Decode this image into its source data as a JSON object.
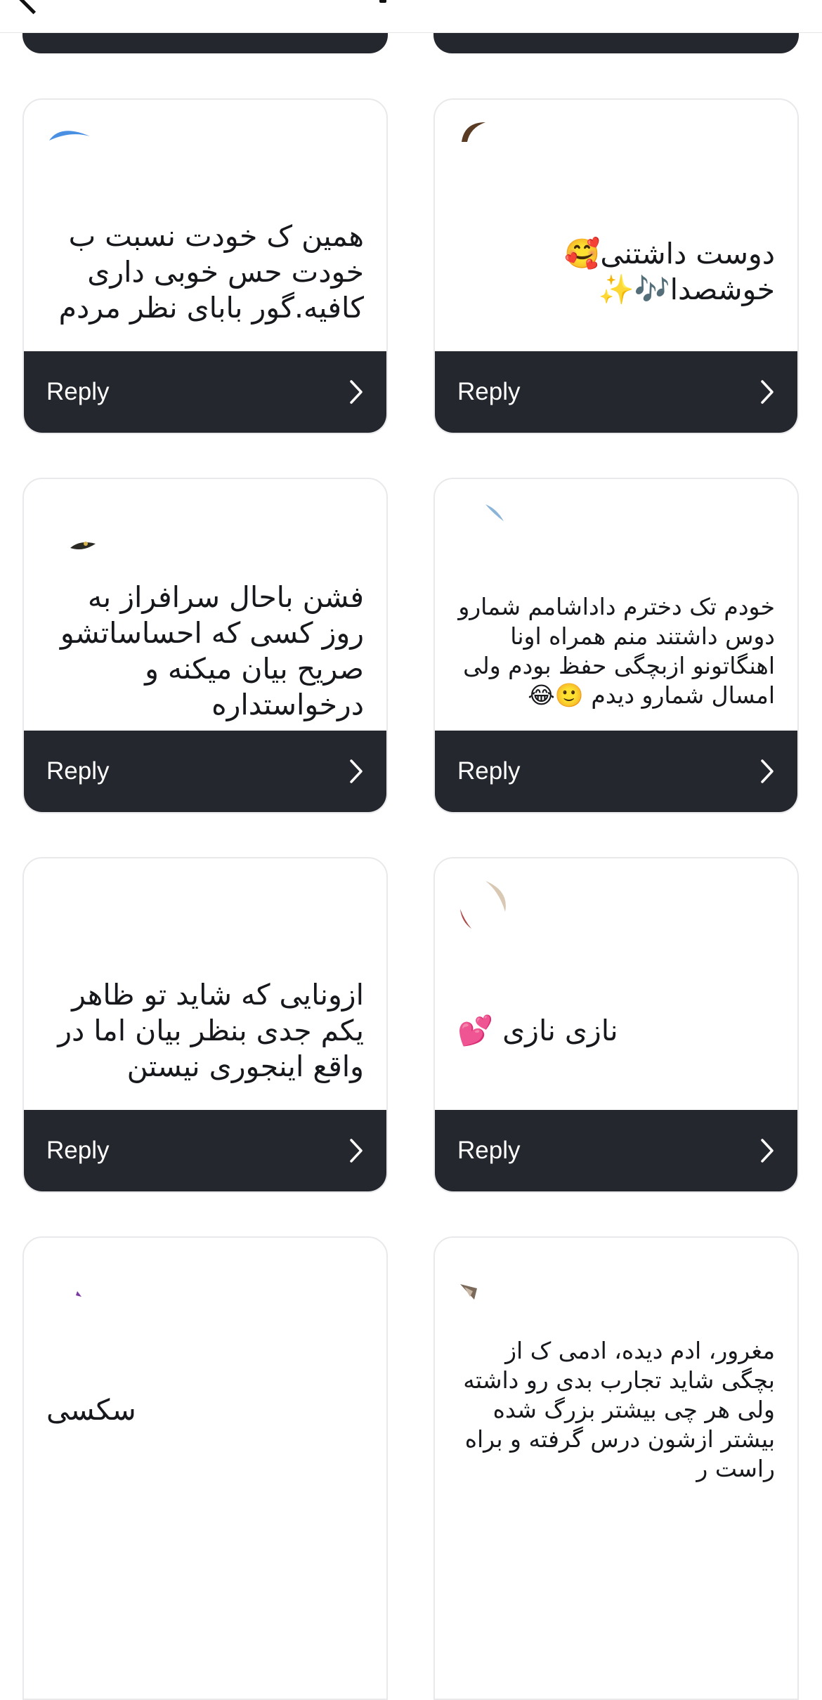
{
  "header": {
    "back_icon": "chevron-left-icon"
  },
  "reply_label": "Reply",
  "chevron_icon": "chevron-right-icon",
  "cards": [
    {
      "text": "همین ک خودت نسبت ب خودت حس خوبی داری کافیه.گور بابای نظر مردم"
    },
    {
      "text": "دوست داشتنی🥰 خوشصدا🎶✨"
    },
    {
      "text": "فشن باحال سرافراز به روز کسی که احساساتشو صریح بیان میکنه و درخواستداره"
    },
    {
      "text": "خودم تک دخترم داداشامم شمارو دوس داشتند منم همراه اونا اهنگاتونو ازبچگی حفظ بودم ولی امسال شمارو دیدم 🙂😂"
    },
    {
      "text": "ازونایی که شاید تو ظاهر یکم جدی بنظر بیان اما در واقع اینجوری نیستن"
    },
    {
      "text": "نازی نازی 💕"
    },
    {
      "text": "سکسی"
    },
    {
      "text": "مغرور، ادم دیده، ادمی ک از بچگی شاید تجارب بدی رو داشته ولی هر چی بیشتر بزرگ شده بیشتر ازشون درس گرفته و براه راست ر"
    }
  ]
}
